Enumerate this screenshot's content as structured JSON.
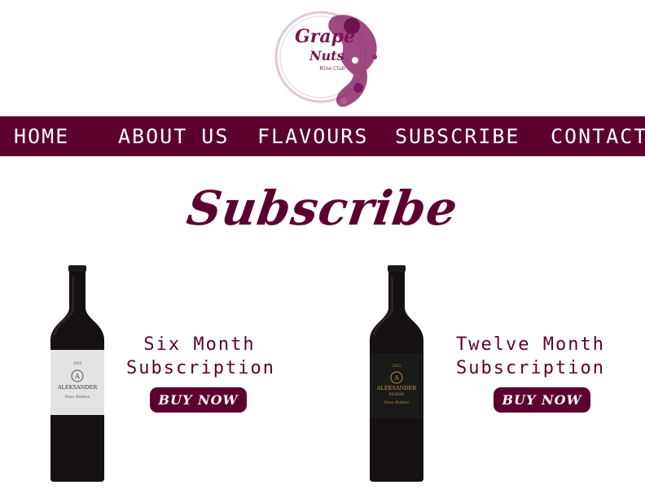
{
  "brand": {
    "line1": "Grape",
    "line2": "Nuts",
    "tagline": "Wine Club"
  },
  "nav": {
    "home": "HOME",
    "about": "ABOUT US",
    "flavours": "FLAVOURS",
    "subscribe": "SUBSCRIBE",
    "contact": "CONTACT"
  },
  "page": {
    "title": "Subscribe"
  },
  "plans": [
    {
      "line1": "Six Month",
      "line2": "Subscription",
      "button": "BUY NOW",
      "bottle": {
        "year": "2015",
        "brand": "ALEKSANDER",
        "sub": "",
        "region": "Paso Robles",
        "label_color": "#e3e3e1"
      }
    },
    {
      "line1": "Twelve Month",
      "line2": "Subscription",
      "button": "BUY NOW",
      "bottle": {
        "year": "2013",
        "brand": "ALEKSANDER",
        "sub": "RESERVE",
        "region": "Paso Robles",
        "label_color": "#1a1a1a"
      }
    }
  ],
  "colors": {
    "accent": "#5c002e",
    "background": "#ffffff",
    "text_light": "#ffffff"
  }
}
